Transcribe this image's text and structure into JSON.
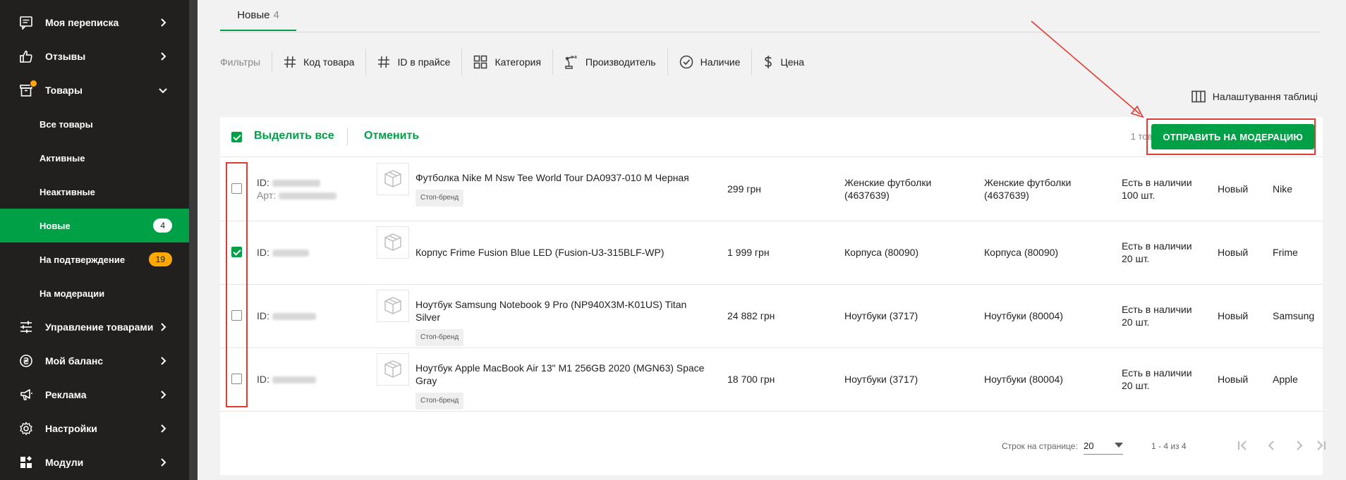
{
  "sidebar": {
    "items": [
      {
        "label": "Моя переписка",
        "icon": "chat-icon"
      },
      {
        "label": "Отзывы",
        "icon": "thumbs-up-icon"
      },
      {
        "label": "Товары",
        "icon": "box-icon"
      },
      {
        "label": "Управление товарами",
        "icon": "sliders-icon"
      },
      {
        "label": "Мой баланс",
        "icon": "currency-icon"
      },
      {
        "label": "Реклама",
        "icon": "megaphone-icon"
      },
      {
        "label": "Настройки",
        "icon": "gear-icon"
      },
      {
        "label": "Модули",
        "icon": "modules-icon"
      }
    ],
    "sub_items": [
      {
        "label": "Все товары"
      },
      {
        "label": "Активные"
      },
      {
        "label": "Неактивные"
      },
      {
        "label": "Новые",
        "badge": "4"
      },
      {
        "label": "На подтверждение",
        "badge": "19"
      },
      {
        "label": "На модерации"
      }
    ]
  },
  "tabs": [
    {
      "label": "Новые",
      "count": "4"
    }
  ],
  "filters": {
    "label": "Фильтры",
    "items": [
      "Код товара",
      "ID в прайсе",
      "Категория",
      "Производитель",
      "Наличие",
      "Цена"
    ]
  },
  "table_settings_label": "Налаштування таблиці",
  "toolbar": {
    "select_all": "Выделить все",
    "cancel": "Отменить",
    "selected_count": "1 тов.",
    "moderate_button": "ОТПРАВИТЬ НА МОДЕРАЦИЮ"
  },
  "id_label": "ID:",
  "art_label": "Арт:",
  "products": [
    {
      "name": "Футболка Nike M Nsw Tee World Tour DA0937-010 M Черная",
      "tag": "Стоп-бренд",
      "price": "299 грн",
      "category": "Женские футболки (4637639)",
      "price_category": "Женские футболки (4637639)",
      "availability": "Есть в наличии 100 шт.",
      "status": "Новый",
      "brand": "Nike",
      "checked": false
    },
    {
      "name": "Корпус Frime Fusion Blue LED (Fusion-U3-315BLF-WP)",
      "tag": "",
      "price": "1 999 грн",
      "category": "Корпуса (80090)",
      "price_category": "Корпуса (80090)",
      "availability": "Есть в наличии 20 шт.",
      "status": "Новый",
      "brand": "Frime",
      "checked": true
    },
    {
      "name": "Ноутбук Samsung Notebook 9 Pro (NP940X3M-K01US) Titan Silver",
      "tag": "Стоп-бренд",
      "price": "24 882 грн",
      "category": "Ноутбуки (3717)",
      "price_category": "Ноутбуки (80004)",
      "availability": "Есть в наличии 20 шт.",
      "status": "Новый",
      "brand": "Samsung",
      "checked": false
    },
    {
      "name": "Ноутбук Apple MacBook Air 13\" M1 256GB 2020 (MGN63) Space Gray",
      "tag": "Стоп-бренд",
      "price": "18 700 грн",
      "category": "Ноутбуки (3717)",
      "price_category": "Ноутбуки (80004)",
      "availability": "Есть в наличии 20 шт.",
      "status": "Новый",
      "brand": "Apple",
      "checked": false
    }
  ],
  "pager": {
    "rows_label": "Строк на странице:",
    "rows_value": "20",
    "range": "1 - 4 из 4"
  },
  "colors": {
    "accent": "#00a046",
    "sidebar": "#221f1f",
    "badge_orange": "#ffa900",
    "annotation": "#e53935"
  }
}
